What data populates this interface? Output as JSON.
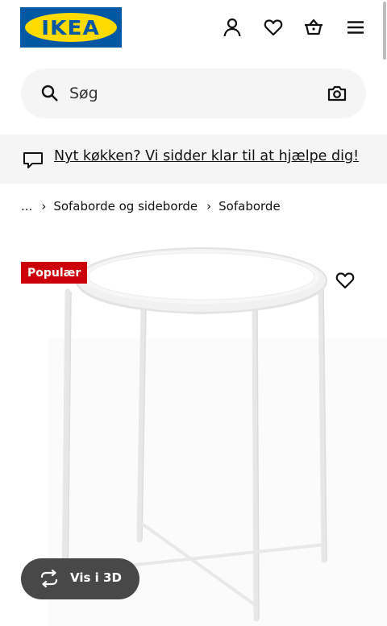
{
  "header": {
    "logo_text": "IKEA",
    "icons": [
      "user-icon",
      "heart-icon",
      "basket-icon",
      "menu-icon"
    ]
  },
  "search": {
    "placeholder": "Søg",
    "icon": "search-icon",
    "camera_icon": "camera-icon"
  },
  "banner": {
    "icon": "chat-icon",
    "link_text": "Nyt køkken? Vi sidder klar til at hjælpe dig!"
  },
  "breadcrumb": {
    "ellipsis": "...",
    "separator": "›",
    "items": [
      "Sofaborde og sideborde",
      "Sofaborde"
    ]
  },
  "product": {
    "badge": "Populær",
    "badge_color": "#cc0008",
    "view3d_label": "Vis i 3D"
  },
  "colors": {
    "brand_blue": "#0058a3",
    "brand_yellow": "#ffdb00"
  }
}
